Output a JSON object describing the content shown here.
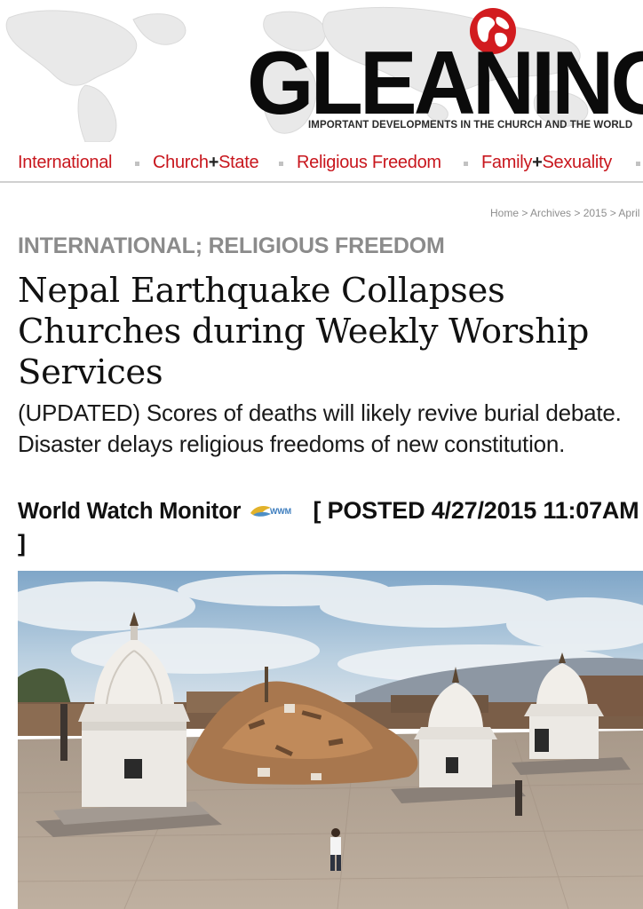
{
  "site": {
    "name": "GLEANINGS",
    "tagline": "IMPORTANT DEVELOPMENTS IN THE CHURCH AND THE WORLD",
    "brand_color": "#c8161d",
    "logo_icon": "globe-icon"
  },
  "nav": {
    "items": [
      {
        "pre": "International",
        "plus": "",
        "post": ""
      },
      {
        "pre": "Church",
        "plus": "+",
        "post": "State"
      },
      {
        "pre": "Religious Freedom",
        "plus": "",
        "post": ""
      },
      {
        "pre": "Family",
        "plus": "+",
        "post": "Sexuality"
      }
    ]
  },
  "breadcrumb": "Home > Archives > 2015 > April",
  "article": {
    "category": "INTERNATIONAL; RELIGIOUS FREEDOM",
    "headline": "Nepal Earthquake Collapses Churches during Weekly Worship Services",
    "deck": "(UPDATED) Scores of deaths will likely revive burial debate. Disaster delays religious freedoms of new constitution.",
    "source": "World Watch Monitor",
    "source_icon": "wwm-logo-icon",
    "source_icon_text": "WWM",
    "posted": "[ POSTED 4/27/2015 11:07AM ]"
  },
  "photo": {
    "subject": "earthquake-damaged temple square with rubble and white shrines"
  }
}
